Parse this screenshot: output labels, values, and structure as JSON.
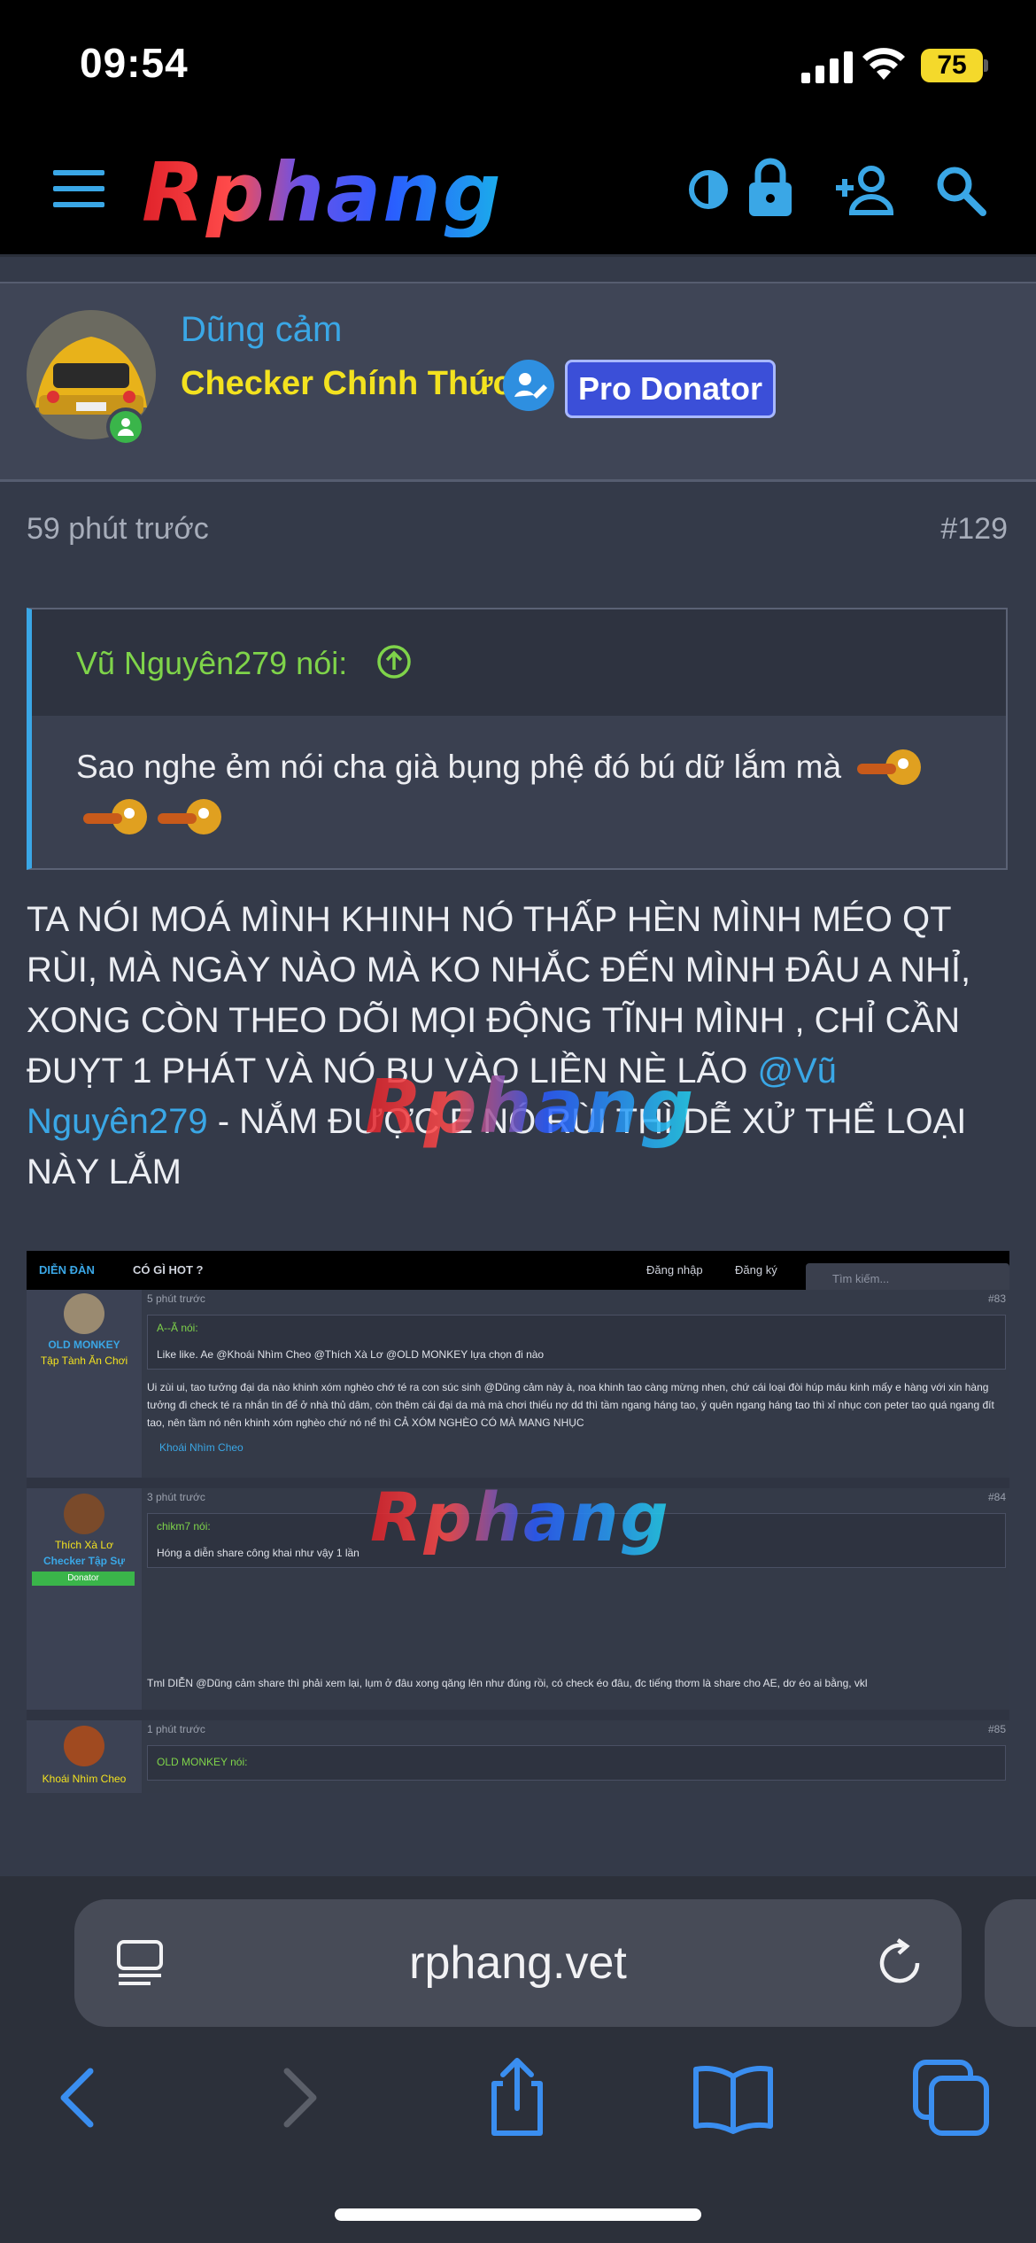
{
  "status_bar": {
    "time": "09:54",
    "battery": "75"
  },
  "nav": {
    "logo_text": "Rphang",
    "icons": [
      "menu-icon",
      "contrast-icon",
      "lock-icon",
      "add-user-icon",
      "search-icon"
    ]
  },
  "user": {
    "name": "Dũng cảm",
    "title": "Checker Chính Thức",
    "badge": "Pro Donator",
    "online": true
  },
  "post": {
    "time": "59 phút trước",
    "number": "#129",
    "quote_author": "Vũ Nguyên279 nói:",
    "quote_text": "Sao nghe ẻm nói cha già bụng phệ đó bú dữ lắm mà",
    "body_before": "TA NÓI MOÁ MÌNH KHINH NÓ THẤP HÈN MÌNH MÉO QT RÙI, MÀ NGÀY NÀO MÀ KO NHẮC ĐẾN MÌNH ĐÂU A NHỈ, XONG CÒN THEO DÕI MỌI ĐỘNG TĨNH MÌNH , CHỈ CẦN ĐUỴT 1 PHÁT VÀ NÓ BU VÀO LIỀN NÈ LÃO ",
    "mention": "@Vũ Nguyên279",
    "body_after": " - NẮM ĐƯỢC E NÓ RÙI THÌ DỄ XỬ THỂ LOẠI NÀY LẮM",
    "watermark": "Rphang"
  },
  "attachment": {
    "nav": {
      "forum": "DIỄN ĐÀN",
      "hot": "CÓ GÌ HOT ?",
      "login": "Đăng nhập",
      "register": "Đăng ký",
      "search_placeholder": "Tìm kiếm..."
    },
    "posts": [
      {
        "user": "OLD MONKEY",
        "rank": "Tập Tành Ăn Chơi",
        "time": "5 phút trước",
        "number": "#83",
        "quote_author": "A--Ã nói:",
        "quote_text": "Like like. Ae @Khoái Nhìm Cheo @Thích Xà Lơ @OLD MONKEY lựa chọn đi nào",
        "text": "Ui zùi ui, tao tưởng đại da nào khinh xóm nghèo chớ té ra con súc sinh @Dũng cảm này à, noa khinh tao càng mừng nhen, chứ cái loại đòi húp máu kinh mấy e hàng với xin hàng tưởng đi check té ra nhắn tin để ở nhà thủ dâm, còn thêm cái đại da mà mà chơi thiếu nợ dd thì tầm ngang háng tao, ý quên ngang háng tao thì xỉ nhục con peter tao quá ngang đít tao, nên tầm nó nên khinh xóm nghèo chứ nó nể thì CẢ XÓM NGHÈO CÓ MÀ MANG NHỤC",
        "reaction": "Khoái Nhìm Cheo"
      },
      {
        "user": "Thích Xà Lơ",
        "rank": "Checker Tập Sự",
        "badge": "Donator",
        "time": "3 phút trước",
        "number": "#84",
        "quote_author": "chikm7 nói:",
        "quote_text": "Hóng a diễn share công khai như vậy 1 lần",
        "text": "Tml DIỄN @Dũng cảm share thì phải xem lại, lụm ở đâu xong qăng lên như đúng rồi, có check éo đâu, đc tiếng thơm là share cho AE, dơ éo ai bằng, vkl"
      },
      {
        "user": "Khoái Nhìm Cheo",
        "time": "1 phút trước",
        "number": "#85",
        "quote_author": "OLD MONKEY nói:"
      }
    ]
  },
  "browser": {
    "url": "rphang.vet"
  },
  "colors": {
    "accent": "#3aa7e6",
    "title_yellow": "#f3e21f",
    "quote_green": "#7fd44a",
    "badge_blue": "#3b4fd8"
  }
}
